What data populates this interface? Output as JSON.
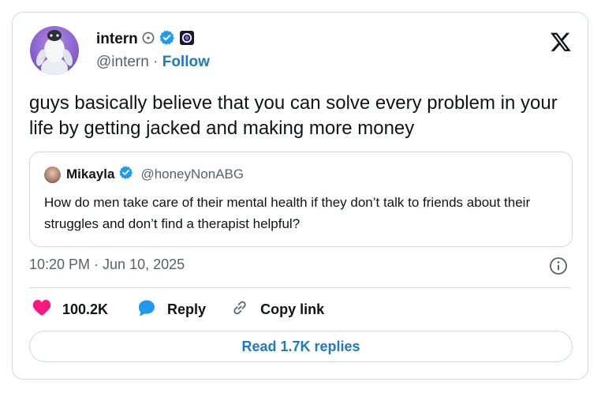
{
  "tweet": {
    "author": {
      "name": "intern",
      "handle": "@intern",
      "separator": "·",
      "follow_label": "Follow",
      "icons": [
        "automated-account-icon",
        "verified-badge-icon",
        "affiliate-badge-icon"
      ]
    },
    "text": "guys basically believe that you can solve every problem in your life by getting jacked and making more money",
    "quoted": {
      "name": "Mikayla",
      "handle": "@honeyNonABG",
      "text": "How do men take care of their mental health if they don’t talk to friends about their struggles and don’t find a therapist helpful?"
    },
    "timestamp": "10:20 PM · Jun 10, 2025",
    "actions": {
      "likes": "100.2K",
      "reply_label": "Reply",
      "copy_label": "Copy link"
    },
    "read_replies_label": "Read 1.7K replies"
  },
  "colors": {
    "link_blue": "#1d79c6",
    "verified_blue": "#1d9bf0",
    "like_pink": "#f91880",
    "muted_text": "#536471",
    "border": "#cfd9de"
  }
}
